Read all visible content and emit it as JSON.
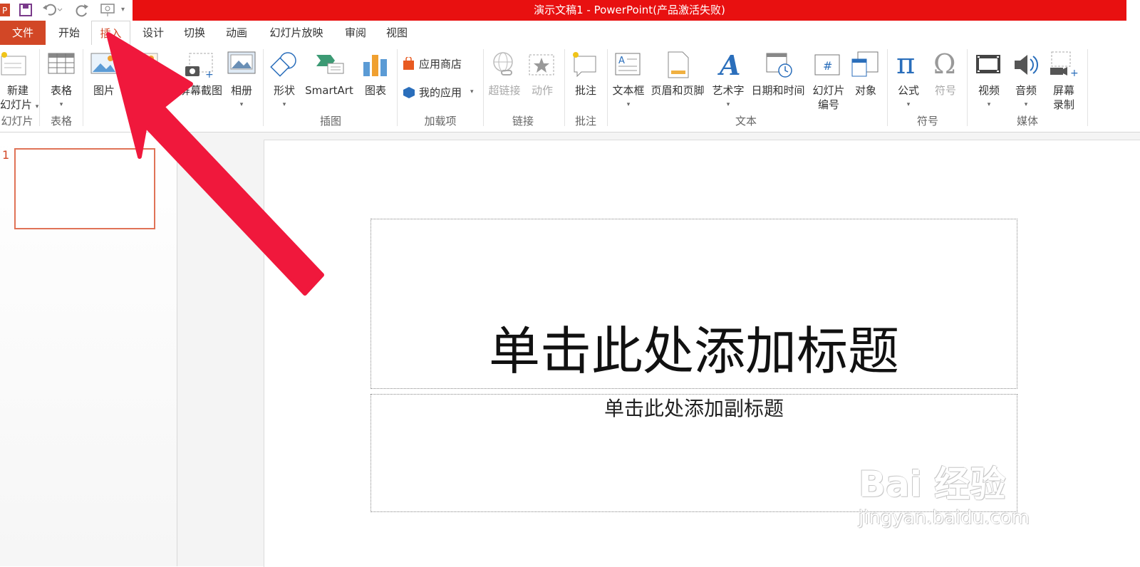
{
  "app": {
    "window_title": "演示文稿1 - PowerPoint(产品激活失败)",
    "accent": "#d24726",
    "titlebar_color": "#e81010"
  },
  "tabs": [
    {
      "label": "文件"
    },
    {
      "label": "开始"
    },
    {
      "label": "插入"
    },
    {
      "label": "设计"
    },
    {
      "label": "切换"
    },
    {
      "label": "动画"
    },
    {
      "label": "幻灯片放映"
    },
    {
      "label": "审阅"
    },
    {
      "label": "视图"
    }
  ],
  "active_tab": "插入",
  "ribbon": {
    "new_slide": "新建",
    "new_slide_2": "幻灯片",
    "table": "表格",
    "picture": "图片",
    "online_picture": "联",
    "screenshot": "屏幕截图",
    "album": "相册",
    "shapes": "形状",
    "smartart": "SmartArt",
    "chart": "图表",
    "app_store": "应用商店",
    "my_apps": "我的应用",
    "hyperlink": "超链接",
    "action": "动作",
    "comment": "批注",
    "textbox": "文本框",
    "header_footer": "页眉和页脚",
    "wordart": "艺术字",
    "date_time": "日期和时间",
    "slide_number": "幻灯片",
    "slide_number_2": "编号",
    "object": "对象",
    "equation": "公式",
    "symbol": "符号",
    "video": "视频",
    "audio": "音频",
    "screen_recording": "屏幕",
    "screen_recording_2": "录制",
    "groups": {
      "slides": "幻灯片",
      "tables": "表格",
      "illustrations": "插图",
      "addins": "加载项",
      "links": "链接",
      "comments": "批注",
      "text": "文本",
      "symbols": "符号",
      "media": "媒体"
    }
  },
  "slides_pane": {
    "thumb_number": "1"
  },
  "slide": {
    "title_placeholder": "单击此处添加标题",
    "subtitle_placeholder": "单击此处添加副标题"
  },
  "watermark": {
    "brand": "Bai 经验",
    "url": "jingyan.baidu.com"
  },
  "annotation": {
    "arrow_color": "#f0183c"
  }
}
